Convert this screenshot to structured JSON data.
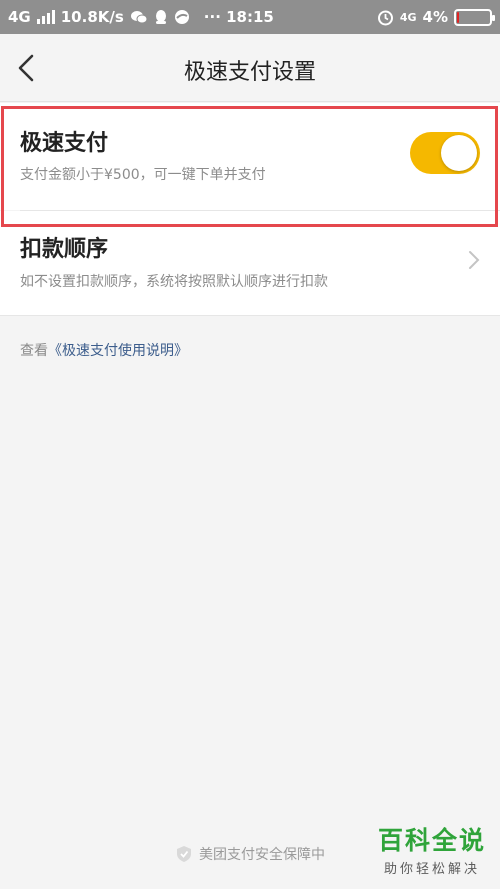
{
  "status_bar": {
    "network": "4G",
    "speed": "10.8K/s",
    "dots": "···",
    "time": "18:15",
    "network_right": "4G",
    "battery": "4%",
    "battery_level": 0.04,
    "icons": [
      "signal-icon",
      "wechat-icon",
      "qq-icon",
      "app-icon",
      "alarm-icon",
      "battery-icon"
    ]
  },
  "nav": {
    "title": "极速支付设置",
    "back_icon": "chevron-left-icon"
  },
  "quick_pay": {
    "title": "极速支付",
    "desc": "支付金额小于¥500，可一键下单并支付",
    "enabled": true,
    "toggle_color": "#f5b800"
  },
  "deduction_order": {
    "title": "扣款顺序",
    "desc": "如不设置扣款顺序，系统将按照默认顺序进行扣款",
    "chevron_icon": "chevron-right-icon"
  },
  "help": {
    "prefix": "查看",
    "link": "《极速支付使用说明》"
  },
  "footer": {
    "text": "美团支付安全保障中",
    "icon": "shield-icon"
  },
  "watermark": {
    "brand": "百科全说",
    "tagline": "助你轻松解决"
  },
  "highlight_color": "#e5474d"
}
